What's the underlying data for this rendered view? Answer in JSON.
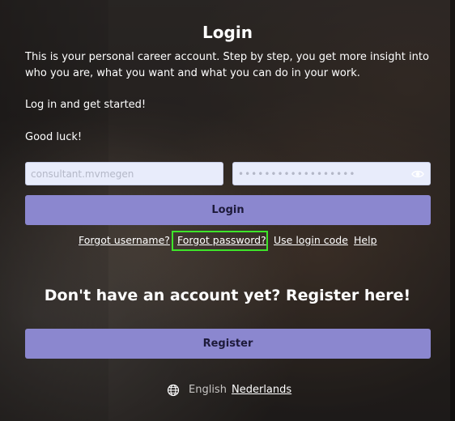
{
  "login": {
    "title": "Login",
    "intro_lines": [
      "This is your personal career account. Step by step, you get more insight into who you are, what you want and what you can do in your work.",
      "Log in and get started!",
      "Good luck!"
    ],
    "username_value": "consultant.mvmegen",
    "password_masked": "••••••••••••••••••",
    "submit_label": "Login",
    "links": {
      "forgot_username": "Forgot username?",
      "forgot_password": "Forgot password?",
      "login_code": "Use login code",
      "help": "Help"
    }
  },
  "register": {
    "title": "Don't have an account yet? Register here!",
    "button_label": "Register"
  },
  "language": {
    "current": "English",
    "other": "Nederlands"
  },
  "icons": {
    "eye": "eye-icon",
    "globe": "globe-icon"
  },
  "colors": {
    "button": "#8b87cf",
    "highlight": "#3ee52a",
    "input_bg": "#e8ecfb"
  }
}
